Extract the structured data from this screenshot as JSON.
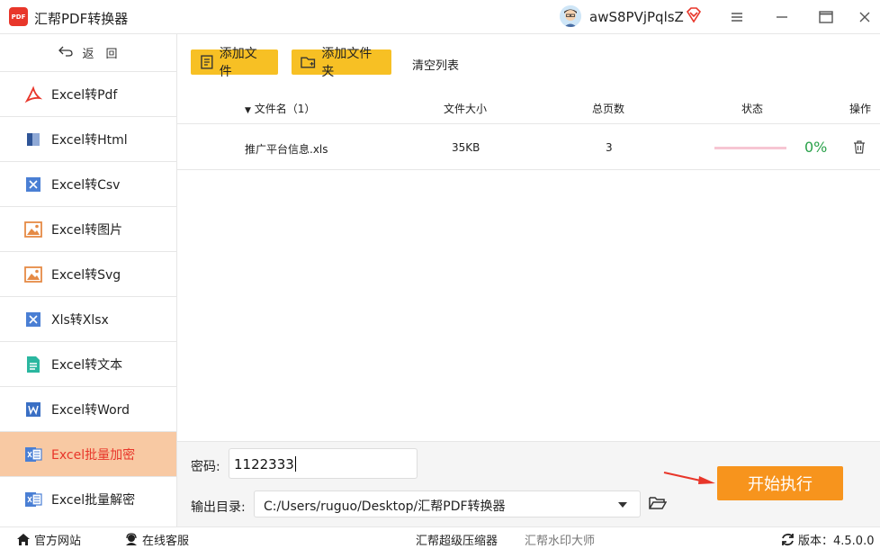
{
  "app": {
    "logo_text": "PDF",
    "title": "汇帮PDF转换器",
    "username": "awS8PVjPqlsZ"
  },
  "sidebar": {
    "back_label": "返　回",
    "items": [
      {
        "label": "Excel转Pdf",
        "icon": "pdf-icon",
        "active": false
      },
      {
        "label": "Excel转Html",
        "icon": "html-icon",
        "active": false
      },
      {
        "label": "Excel转Csv",
        "icon": "csv-icon",
        "active": false
      },
      {
        "label": "Excel转图片",
        "icon": "image-icon",
        "active": false
      },
      {
        "label": "Excel转Svg",
        "icon": "svg-image-icon",
        "active": false
      },
      {
        "label": "Xls转Xlsx",
        "icon": "xlsx-icon",
        "active": false
      },
      {
        "label": "Excel转文本",
        "icon": "text-icon",
        "active": false
      },
      {
        "label": "Excel转Word",
        "icon": "word-icon",
        "active": false
      },
      {
        "label": "Excel批量加密",
        "icon": "excel-lock-icon",
        "active": true
      },
      {
        "label": "Excel批量解密",
        "icon": "excel-unlock-icon",
        "active": false
      }
    ]
  },
  "toolbar": {
    "add_file": "添加文件",
    "add_folder": "添加文件夹",
    "clear_list": "清空列表"
  },
  "table": {
    "headers": {
      "name": "文件名（1）",
      "size": "文件大小",
      "pages": "总页数",
      "status": "状态",
      "action": "操作"
    },
    "rows": [
      {
        "name": "推广平台信息.xls",
        "size": "35KB",
        "pages": "3",
        "progress": 0,
        "percent": "0%"
      }
    ]
  },
  "options": {
    "password_label": "密码:",
    "password_value": "1122333",
    "output_label": "输出目录:",
    "output_path": "C:/Users/ruguo/Desktop/汇帮PDF转换器",
    "start_button": "开始执行"
  },
  "footer": {
    "official_site": "官方网站",
    "online_service": "在线客服",
    "compress_tool": "汇帮超级压缩器",
    "watermark_tool": "汇帮水印大师",
    "version": "版本：4.5.0.0"
  },
  "colors": {
    "accent_yellow": "#f7c024",
    "start_orange": "#f7941d",
    "active_bg": "#f8c9a3",
    "active_text": "#e8362a",
    "percent_green": "#2aa14a"
  }
}
